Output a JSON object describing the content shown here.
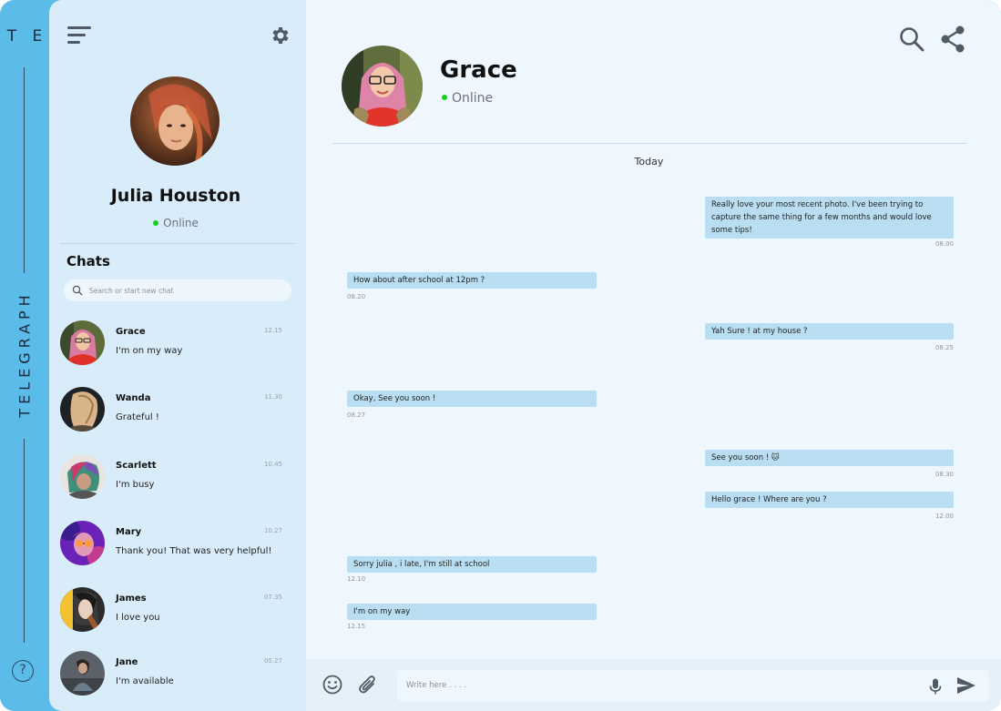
{
  "app": {
    "brand_short": "T E",
    "brand_word": "TELEGRAPH",
    "help_glyph": "?"
  },
  "icons": {
    "menu": "hamburger-icon",
    "settings": "gear-icon",
    "search": "search-icon",
    "share": "share-icon",
    "emoji": "smiley-icon",
    "attach": "paperclip-icon",
    "mic": "microphone-icon",
    "send": "send-icon",
    "help": "question-icon"
  },
  "colors": {
    "brand": "#5bbbe9",
    "sidebar": "#d8edf9",
    "main": "#eef7fd",
    "bubble": "#b9def2",
    "online": "#15d11c"
  },
  "profile": {
    "name": "Julia Houston",
    "status": "Online"
  },
  "sidebar": {
    "chats_heading": "Chats",
    "search_placeholder": "Search or start new chat",
    "chats": [
      {
        "name": "Grace",
        "time": "12.15",
        "message": "I'm on my way"
      },
      {
        "name": "Wanda",
        "time": "11.30",
        "message": "Grateful !"
      },
      {
        "name": "Scarlett",
        "time": "10.45",
        "message": "I'm busy"
      },
      {
        "name": "Mary",
        "time": "10.27",
        "message": "Thank you! That was very helpful!"
      },
      {
        "name": "James",
        "time": "07.35",
        "message": "I love you"
      },
      {
        "name": "Jane",
        "time": "05.27",
        "message": "I'm available"
      }
    ]
  },
  "conversation": {
    "contact_name": "Grace",
    "contact_status": "Online",
    "day_label": "Today",
    "messages": [
      {
        "side": "out",
        "text": "Really love your most recent photo. I've been trying to capture the same thing for a few months and would love some tips!",
        "time": "08.00"
      },
      {
        "side": "in",
        "text": "How about after school at 12pm ?",
        "time": "08.20"
      },
      {
        "side": "out",
        "text": "Yah Sure ! at my house ?",
        "time": "08.25"
      },
      {
        "side": "in",
        "text": "Okay, See you soon !",
        "time": "08.27"
      },
      {
        "side": "out",
        "text": "See you soon ! 🐱",
        "time": "08.30"
      },
      {
        "side": "out",
        "text": "Hello grace ! Where are you ?",
        "time": "12.00"
      },
      {
        "side": "in",
        "text": "Sorry julia ,  i late, I'm still at school",
        "time": "12.10"
      },
      {
        "side": "in",
        "text": "I'm on my way",
        "time": "12.15"
      }
    ]
  },
  "composer": {
    "placeholder": "Write here . . . ."
  }
}
